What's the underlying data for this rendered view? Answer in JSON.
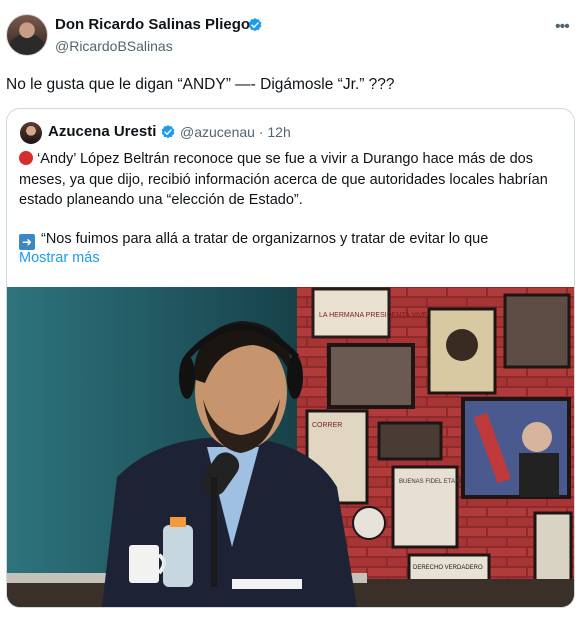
{
  "tweet": {
    "author_name": "Don Ricardo Salinas Pliego",
    "author_handle": "@RicardoBSalinas",
    "text": "No le gusta que le digan “ANDY” —- Digámosle “Jr.” ???",
    "more_icon": "more-options-icon"
  },
  "quote": {
    "author_name": "Azucena Uresti",
    "author_handle": "@azucenau · 12h",
    "paragraph1": "‘Andy’ López Beltrán reconoce que se fue a vivir a Durango hace más de dos meses, ya que dijo, recibió información acerca de que autoridades locales habrían estado planeando una “elección de Estado”.",
    "paragraph2": "“Nos fuimos para allá a tratar de organizarnos y tratar de evitar lo que",
    "show_more": "Mostrar más",
    "media_alt": "Video thumbnail"
  },
  "colors": {
    "verified": "#1d9bf0",
    "link": "#1d9bf0",
    "secondary_text": "#536471"
  },
  "poster_text": {
    "poster_top": "LA HERMANA PRESIDENTA VIVE",
    "poster_left": "CORRER",
    "poster_books": "BUENAS FIDEL ETA MAS",
    "poster_bottom": "DERECHO VERDADERO"
  }
}
